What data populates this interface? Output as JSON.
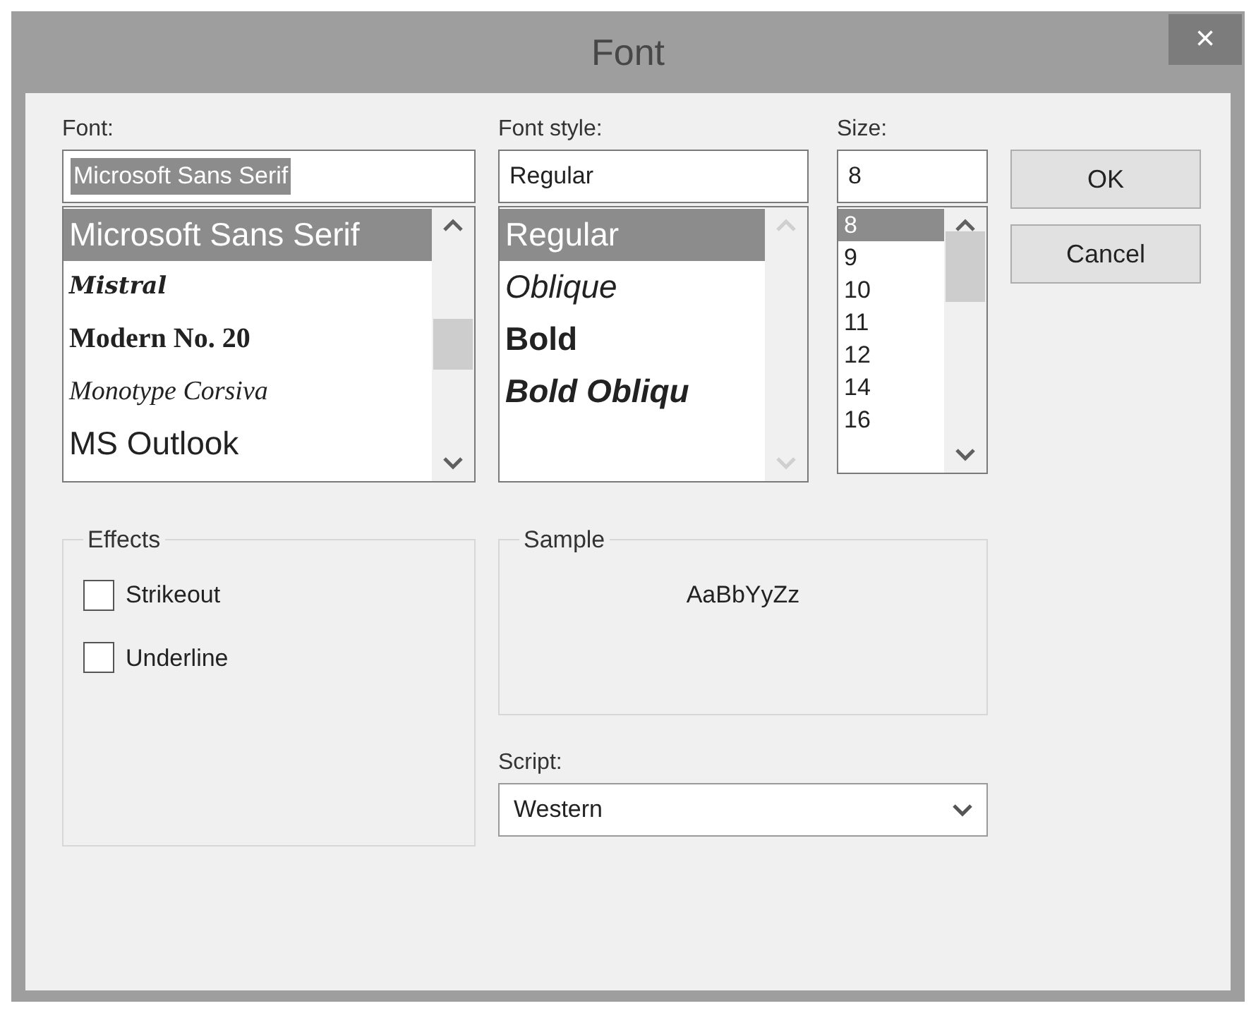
{
  "window": {
    "title": "Font",
    "close": "×"
  },
  "font": {
    "label": "Font:",
    "value": "Microsoft Sans Serif",
    "value_selected": true,
    "scroll_disabled": false,
    "items": [
      {
        "text": "Microsoft Sans Serif",
        "kind": "sans",
        "selected": true
      },
      {
        "text": "Mistral",
        "kind": "script",
        "selected": false
      },
      {
        "text": "Modern No. 20",
        "kind": "serif-bold",
        "selected": false
      },
      {
        "text": "Monotype Corsiva",
        "kind": "serif-italic",
        "selected": false
      },
      {
        "text": "MS Outlook",
        "kind": "sans",
        "selected": false
      }
    ]
  },
  "font_style": {
    "label": "Font style:",
    "value": "Regular",
    "value_selected": false,
    "scroll_disabled": true,
    "items": [
      {
        "text": "Regular",
        "kind": "regular",
        "selected": true
      },
      {
        "text": "Oblique",
        "kind": "italic",
        "selected": false
      },
      {
        "text": "Bold",
        "kind": "bold",
        "selected": false
      },
      {
        "text": "Bold Obliqu",
        "kind": "bold-italic",
        "selected": false
      }
    ]
  },
  "size": {
    "label": "Size:",
    "value": "8",
    "value_selected": false,
    "scroll_disabled": false,
    "items": [
      {
        "text": "8",
        "kind": "plain",
        "selected": true
      },
      {
        "text": "9",
        "kind": "plain",
        "selected": false
      },
      {
        "text": "10",
        "kind": "plain",
        "selected": false
      },
      {
        "text": "11",
        "kind": "plain",
        "selected": false
      },
      {
        "text": "12",
        "kind": "plain",
        "selected": false
      },
      {
        "text": "14",
        "kind": "plain",
        "selected": false
      },
      {
        "text": "16",
        "kind": "plain",
        "selected": false
      }
    ]
  },
  "buttons": [
    "OK",
    "Cancel"
  ],
  "effects": {
    "title": "Effects",
    "options": [
      {
        "label": "Strikeout",
        "checked": false
      },
      {
        "label": "Underline",
        "checked": false
      }
    ]
  },
  "sample": {
    "title": "Sample",
    "text": "AaBbYyZz"
  },
  "script": {
    "label": "Script:",
    "value": "Western"
  }
}
